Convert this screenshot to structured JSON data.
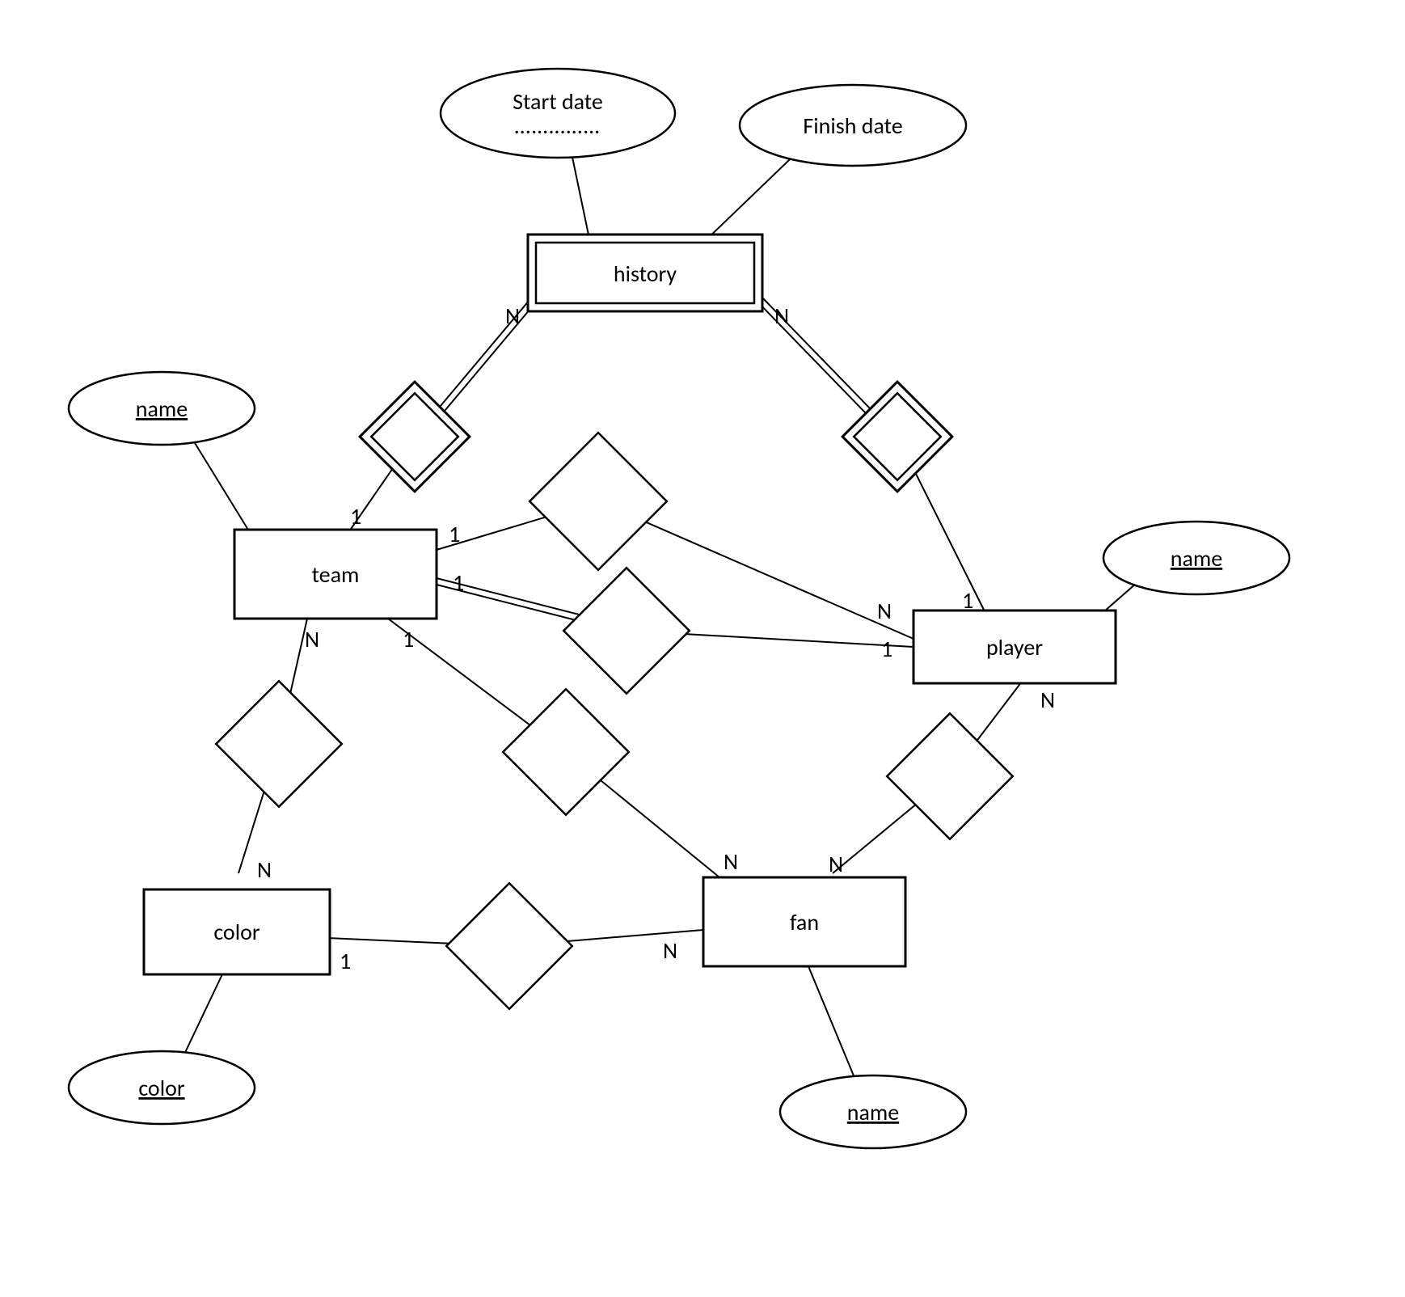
{
  "entities": {
    "history": "history",
    "team": "team",
    "player": "player",
    "color": "color",
    "fan": "fan"
  },
  "attributes": {
    "start_date": "Start date",
    "start_date_dots": "……………",
    "finish_date": "Finish date",
    "team_name": "name",
    "player_name": "name",
    "color_color": "color",
    "fan_name": "name"
  },
  "cardinalities": {
    "history_left_N": "N",
    "history_right_N": "N",
    "team_up_1": "1",
    "team_diamond1_1": "1",
    "team_diamond2_1": "1",
    "team_down_1": "1",
    "team_color_N": "N",
    "player_up_1": "1",
    "player_left_N": "N",
    "player_diamond2_1": "1",
    "player_fan_N": "N",
    "color_N": "N",
    "color_fan_1": "1",
    "fan_color_N": "N",
    "fan_player_N": "N",
    "fan_team_N": "N"
  }
}
